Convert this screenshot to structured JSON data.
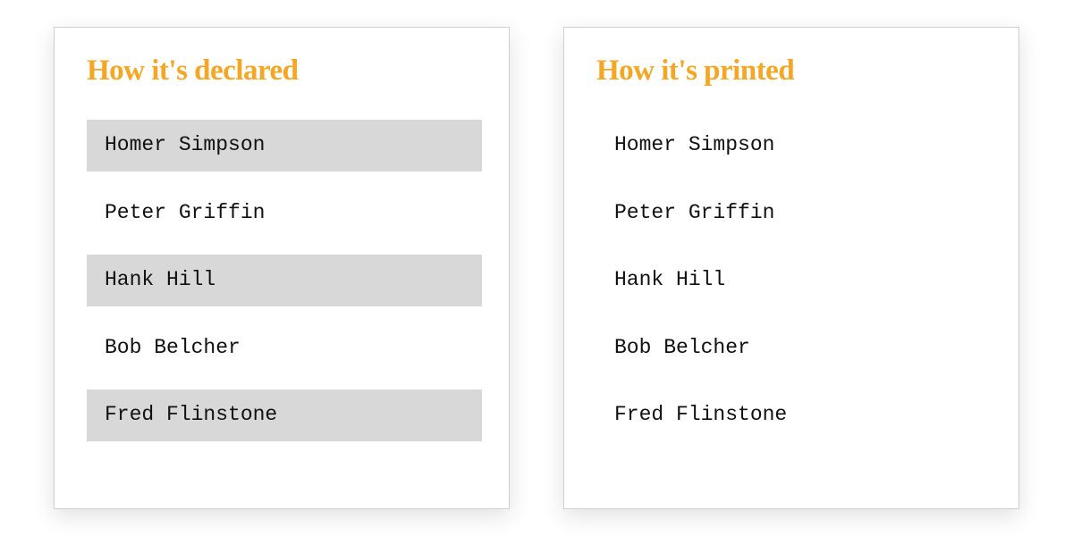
{
  "cards": {
    "declared": {
      "title": "How it's declared",
      "items": [
        "Homer Simpson",
        "Peter Griffin",
        "Hank Hill",
        "Bob Belcher",
        "Fred Flinstone"
      ]
    },
    "printed": {
      "title": "How it's printed",
      "items": [
        "Homer Simpson",
        "Peter Griffin",
        "Hank Hill",
        "Bob Belcher",
        "Fred Flinstone"
      ]
    }
  },
  "colors": {
    "accent": "#f5a623",
    "stripe": "#d8d8d8"
  }
}
